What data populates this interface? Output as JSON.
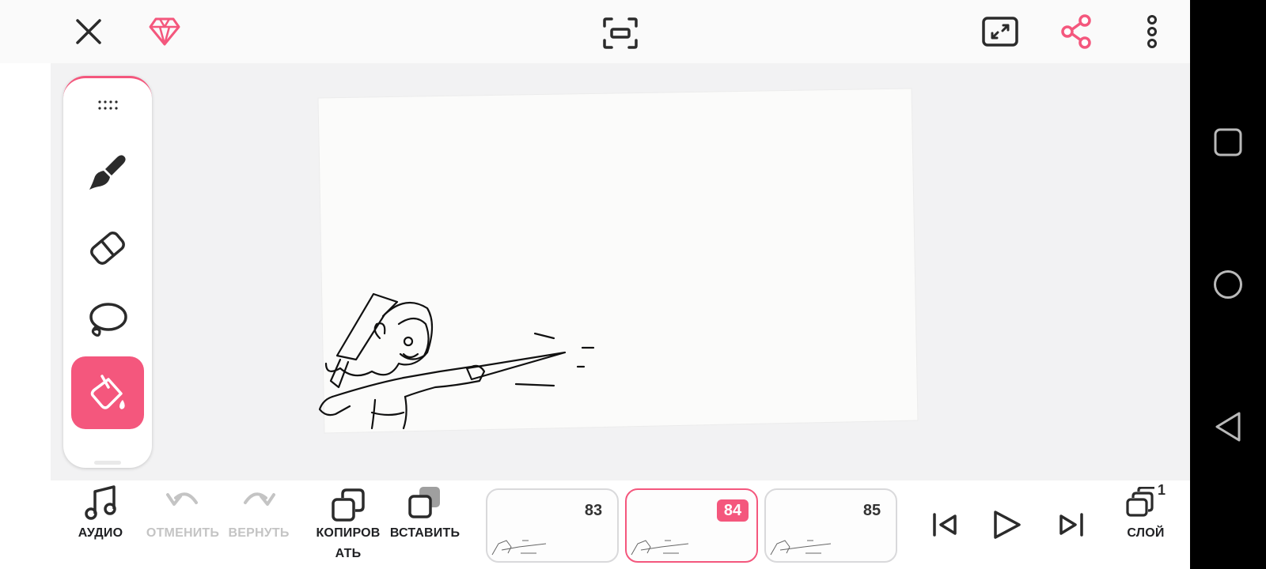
{
  "colors": {
    "accent": "#f4577d",
    "icon": "#2b2b2b",
    "disabled": "#c4c4c4"
  },
  "topbar": {
    "icons": [
      "close-icon",
      "premium-diamond-icon",
      "fit-to-screen-icon",
      "fullscreen-icon",
      "share-icon",
      "more-vertical-icon"
    ]
  },
  "toolbar": {
    "tools": [
      "brush-icon",
      "eraser-icon",
      "lasso-icon",
      "fill-bucket-icon"
    ],
    "active_tool": "fill-bucket-icon"
  },
  "bottombar": {
    "audio_label": "АУДИО",
    "undo_label": "ОТМЕНИТЬ",
    "redo_label": "ВЕРНУТЬ",
    "copy_label": "КОПИРОВАТЬ",
    "paste_label": "ВСТАВИТЬ",
    "layer_label": "СЛОЙ",
    "layer_count": "1",
    "frames": [
      {
        "number": "83",
        "active": false
      },
      {
        "number": "84",
        "active": true
      },
      {
        "number": "85",
        "active": false
      }
    ]
  },
  "navbar": {
    "icons": [
      "recents-square-icon",
      "home-circle-icon",
      "back-triangle-icon"
    ]
  }
}
